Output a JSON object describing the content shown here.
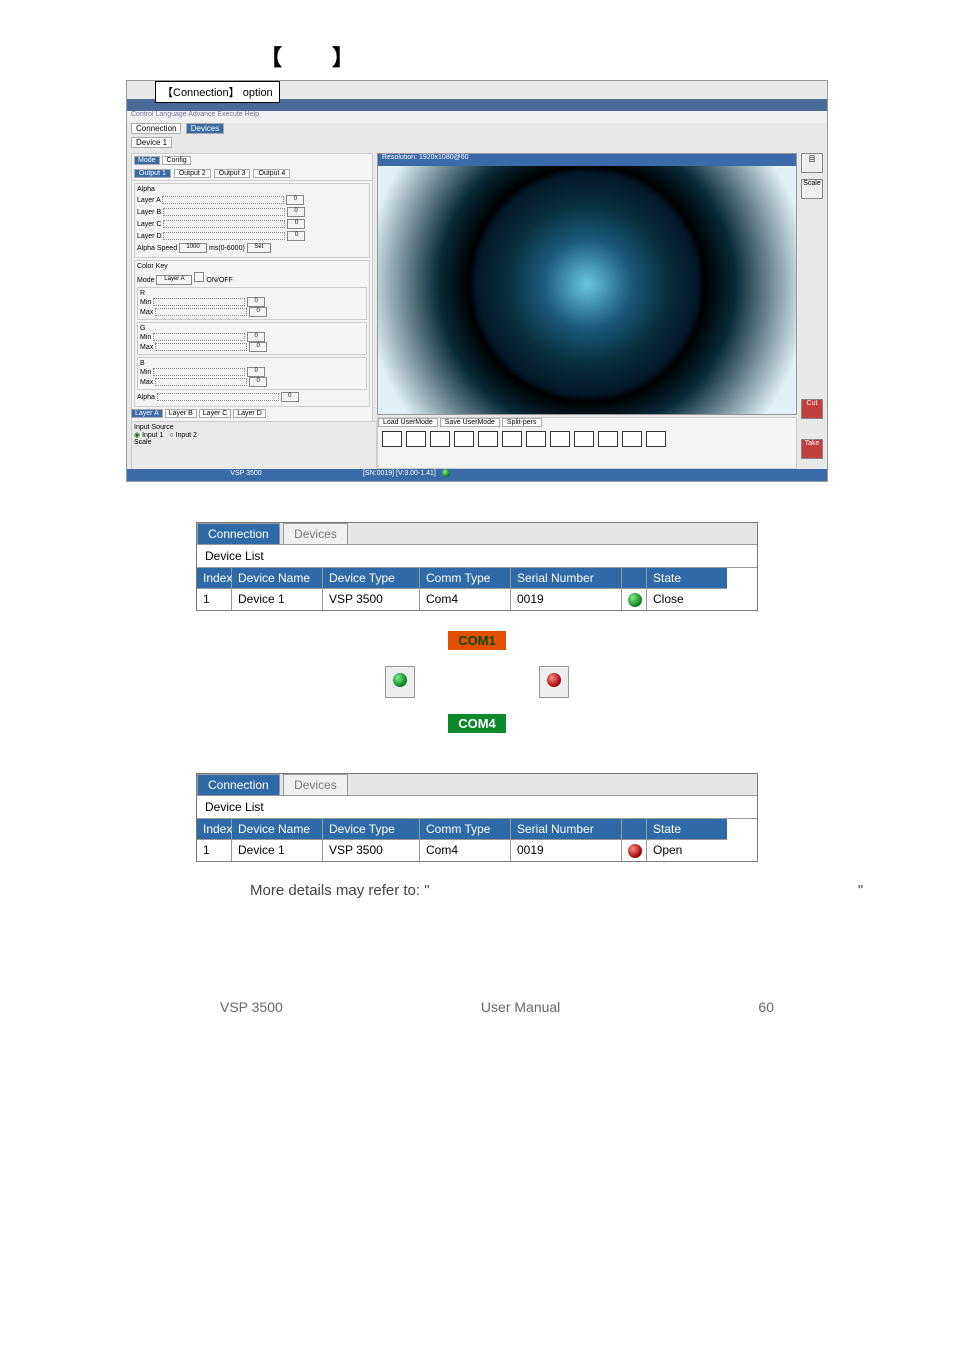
{
  "bracket_row": {
    "left": "【",
    "right": "】"
  },
  "callout": "【Connection】 option",
  "app": {
    "menu": "Control  Language  Advance  Execute  Help",
    "toolbar": {
      "conn": "Connection",
      "dev": "Devices"
    },
    "device_tab": "Device 1",
    "left_tabs": {
      "mode": "Mode",
      "config": "Config"
    },
    "outputs": [
      "Output 1",
      "Output 2",
      "Output 3",
      "Output 4"
    ],
    "alpha_section": "Alpha",
    "layers": [
      "Layer A",
      "Layer B",
      "Layer C",
      "Layer D"
    ],
    "layer_val": "0",
    "alpha_speed_label": "Alpha Speed",
    "alpha_speed_val": "1000",
    "alpha_speed_unit": "ms(0-6000)",
    "set_btn": "Set",
    "colorkey": "Color Key",
    "mode_label": "Mode",
    "mode_val": "Layer A",
    "onoff": "ON/OFF",
    "rgb": [
      "R",
      "G",
      "B"
    ],
    "min": "Min",
    "max": "Max",
    "zero": "0",
    "alpha_label": "Alpha",
    "layer_tabs": [
      "Layer A",
      "Layer B",
      "Layer C",
      "Layer D"
    ],
    "input_source": "Input Source",
    "in1": "Input 1",
    "in2": "Input 2",
    "scale": "Scale",
    "preview_title": "Resolution: 1920x1080@60",
    "bp_tabs": [
      "Load UserMode",
      "Save UserMode",
      "Split-pers"
    ],
    "right_buttons": [
      "目",
      "Scale",
      "Cut",
      "Take"
    ],
    "status_left": "VSP 3500",
    "status_mid": "[SN:0019] [V:3.00-1.41]"
  },
  "device_table": {
    "tab1": "Connection",
    "tab2": "Devices",
    "caption": "Device List",
    "headers": {
      "index": "Index",
      "name": "Device Name",
      "type": "Device Type",
      "comm": "Comm Type",
      "sn": "Serial Number",
      "state": "State"
    },
    "row1": {
      "index": "1",
      "name": "Device 1",
      "type": "VSP 3500",
      "comm": "Com4",
      "sn": "0019",
      "state_close": "Close",
      "state_open": "Open"
    }
  },
  "com_labels": {
    "com1": "COM1",
    "com4": "COM4"
  },
  "more_details_prefix": "More details may refer to: \"",
  "more_details_suffix": "\"",
  "footer": {
    "left": "VSP 3500",
    "mid": "User Manual",
    "right": "60"
  }
}
